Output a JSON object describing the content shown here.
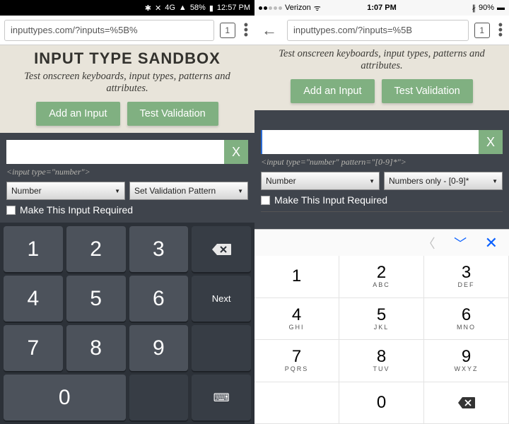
{
  "android": {
    "status": {
      "battery": "58%",
      "time": "12:57 PM",
      "net": "4G"
    },
    "url": "inputtypes.com/?inputs=%5B%",
    "tabs": "1",
    "page": {
      "title": "INPUT TYPE SANDBOX",
      "subtitle": "Test onscreen keyboards, input types, patterns and attributes.",
      "btn_add": "Add an Input",
      "btn_test": "Test Validation"
    },
    "panel": {
      "hint": "<input type=\"number\">",
      "sel1": "Number",
      "sel2": "Set Validation Pattern",
      "chk": "Make This Input Required"
    },
    "keys": {
      "k1": "1",
      "k2": "2",
      "k3": "3",
      "k4": "4",
      "k5": "5",
      "k6": "6",
      "k7": "7",
      "k8": "8",
      "k9": "9",
      "k0": "0",
      "next": "Next"
    }
  },
  "ios": {
    "status": {
      "carrier": "Verizon",
      "time": "1:07 PM",
      "battery": "90%"
    },
    "url": "inputtypes.com/?inputs=%5B",
    "tabs": "1",
    "page": {
      "subtitle": "Test onscreen keyboards, input types, patterns and attributes.",
      "btn_add": "Add an Input",
      "btn_test": "Test Validation"
    },
    "panel": {
      "hint": "<input type=\"number\" pattern=\"[0-9]*\">",
      "sel1": "Number",
      "sel2": "Numbers only - [0-9]*",
      "chk": "Make This Input Required"
    },
    "keys": {
      "k1": {
        "n": "1",
        "l": ""
      },
      "k2": {
        "n": "2",
        "l": "ABC"
      },
      "k3": {
        "n": "3",
        "l": "DEF"
      },
      "k4": {
        "n": "4",
        "l": "GHI"
      },
      "k5": {
        "n": "5",
        "l": "JKL"
      },
      "k6": {
        "n": "6",
        "l": "MNO"
      },
      "k7": {
        "n": "7",
        "l": "PQRS"
      },
      "k8": {
        "n": "8",
        "l": "TUV"
      },
      "k9": {
        "n": "9",
        "l": "WXYZ"
      },
      "k0": {
        "n": "0",
        "l": ""
      }
    }
  }
}
